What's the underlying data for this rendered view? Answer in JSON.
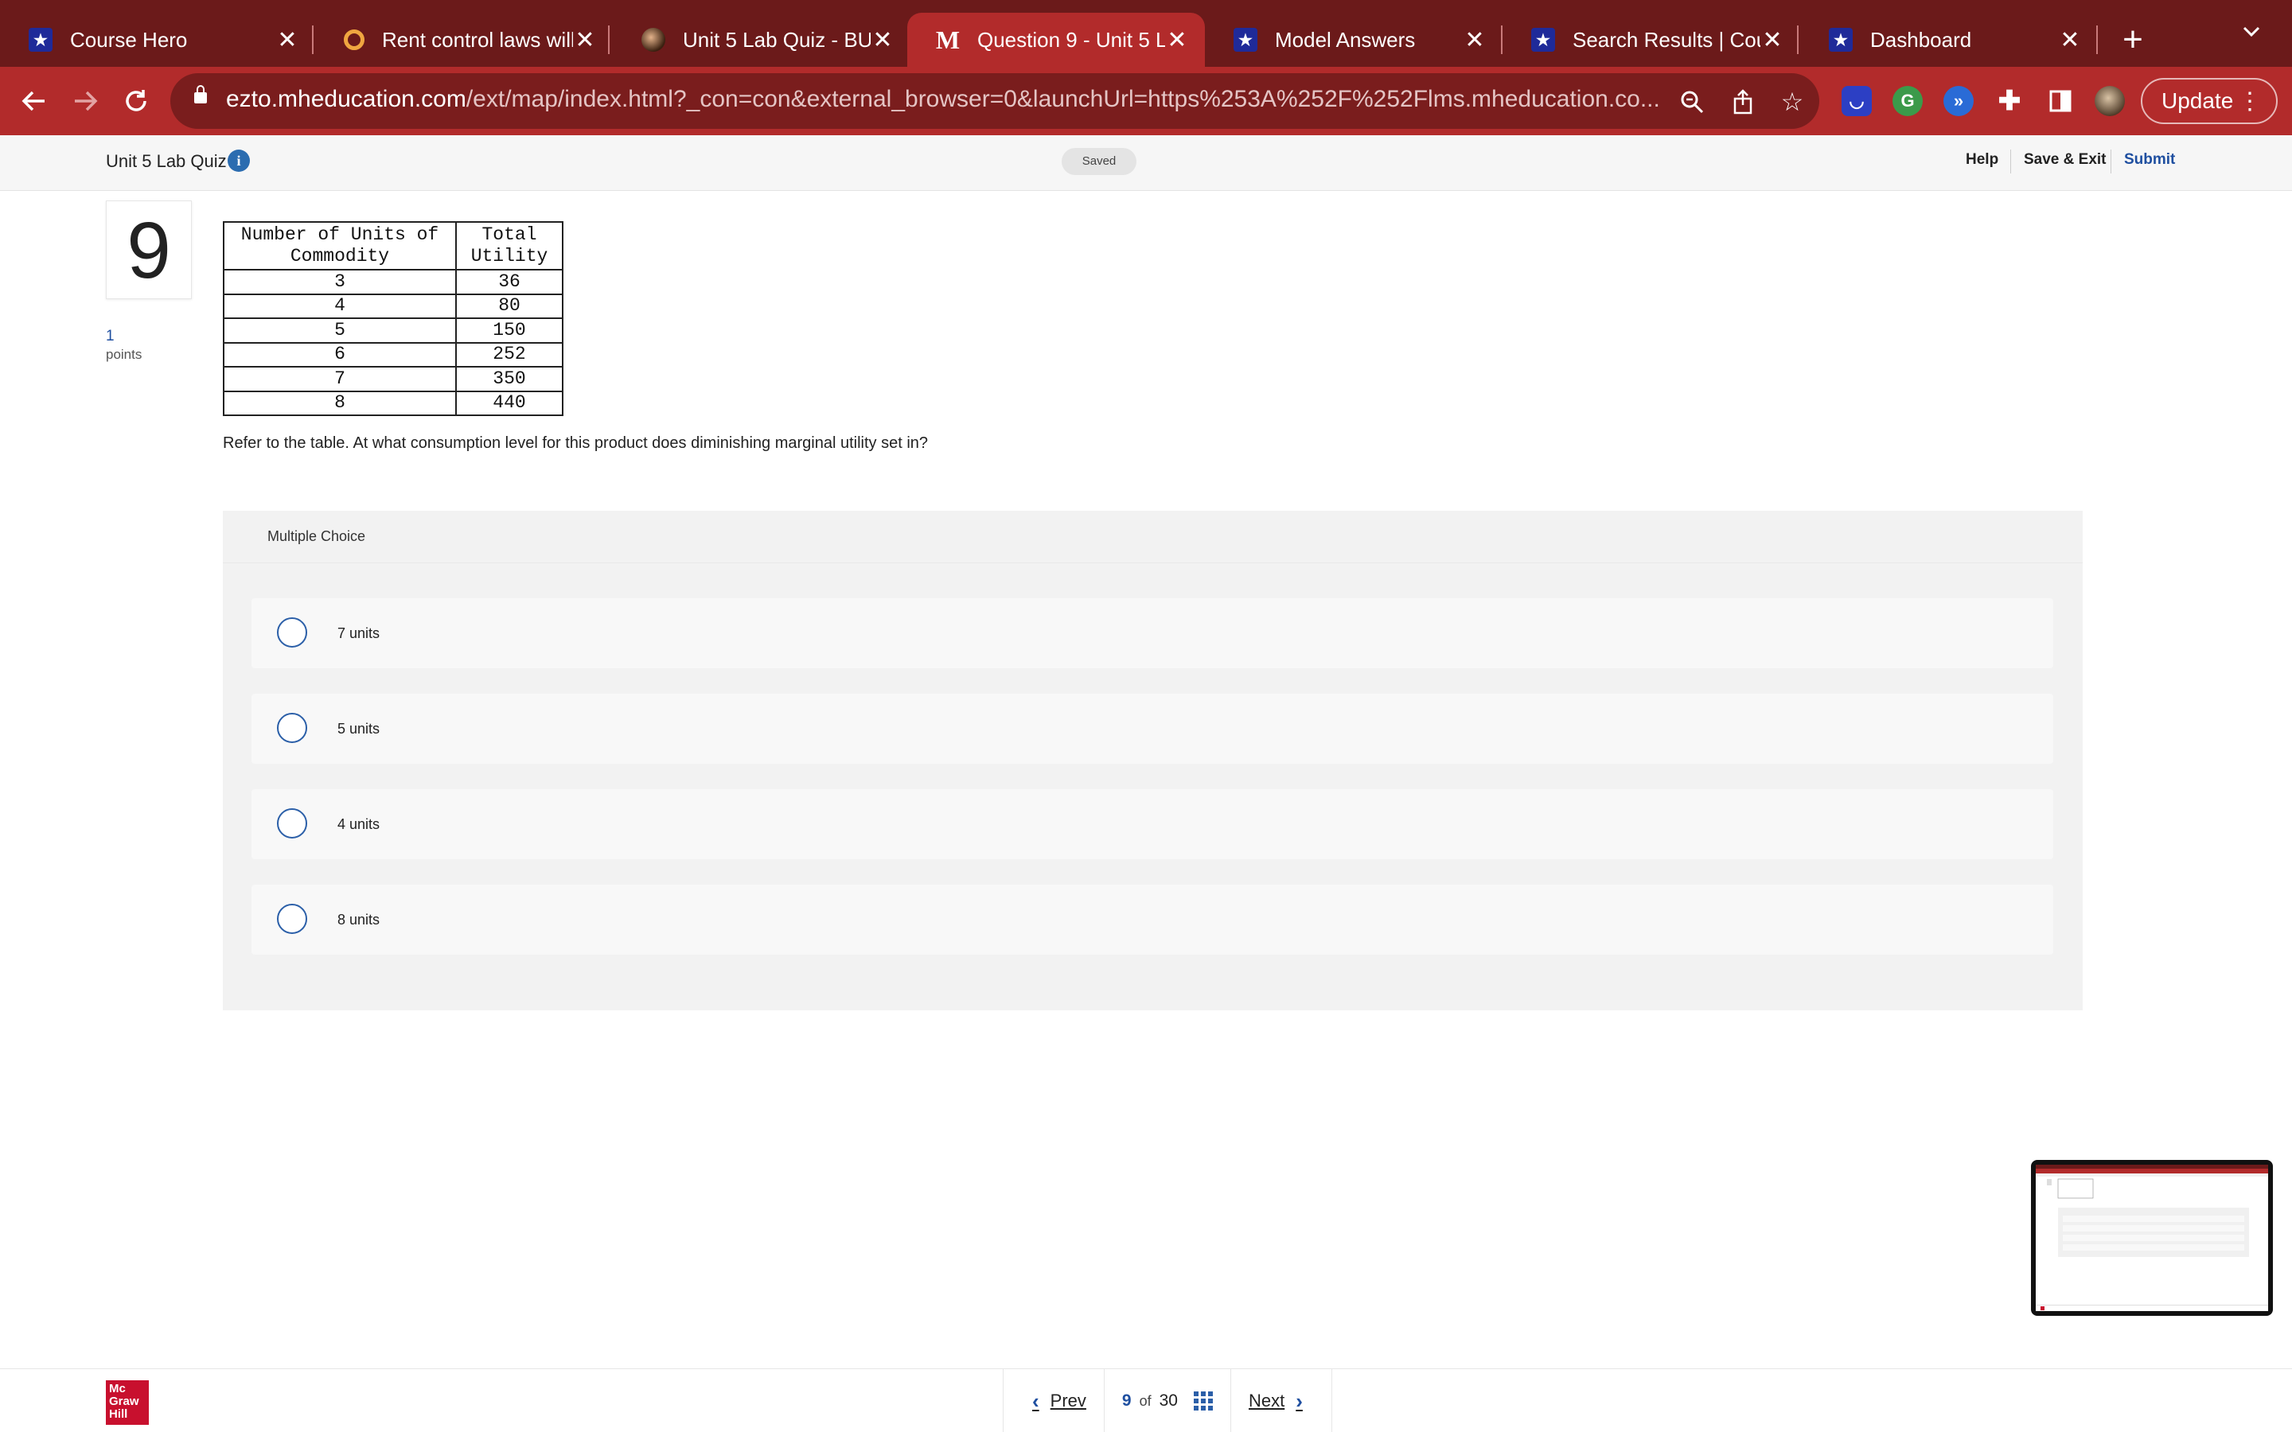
{
  "browser": {
    "tabs": [
      {
        "title": "Course Hero",
        "icon": "star-bookmark-icon",
        "active": false
      },
      {
        "title": "Rent control laws will",
        "icon": "ring-icon",
        "active": false
      },
      {
        "title": "Unit 5 Lab Quiz - BU",
        "icon": "profile-photo-icon",
        "active": false
      },
      {
        "title": "Question 9 - Unit 5 L",
        "icon": "mcgraw-m-icon",
        "active": true
      },
      {
        "title": "Model Answers",
        "icon": "star-bookmark-icon",
        "active": false
      },
      {
        "title": "Search Results | Cou",
        "icon": "star-bookmark-icon",
        "active": false
      },
      {
        "title": "Dashboard",
        "icon": "star-bookmark-icon",
        "active": false
      }
    ],
    "url_host": "ezto.mheducation.com",
    "url_rest": "/ext/map/index.html?_con=con&external_browser=0&launchUrl=https%253A%252F%252Flms.mheducation.co...",
    "update_label": "Update",
    "colors": {
      "tabbar": "#6b1a1a",
      "toolbar": "#b22b2b"
    }
  },
  "header": {
    "quiz_title": "Unit 5 Lab Quiz",
    "status": "Saved",
    "help": "Help",
    "save_exit": "Save & Exit",
    "submit": "Submit"
  },
  "question": {
    "number": "9",
    "points_value": "1",
    "points_label": "points",
    "table": {
      "headers": [
        [
          "Number of Units of",
          "Commodity"
        ],
        [
          "Total",
          "Utility"
        ]
      ],
      "rows": [
        [
          "3",
          "36"
        ],
        [
          "4",
          "80"
        ],
        [
          "5",
          "150"
        ],
        [
          "6",
          "252"
        ],
        [
          "7",
          "350"
        ],
        [
          "8",
          "440"
        ]
      ]
    },
    "prompt": "Refer to the table. At what consumption level for this product does diminishing marginal utility set in?",
    "section_label": "Multiple Choice",
    "choices": [
      "7 units",
      "5 units",
      "4 units",
      "8 units"
    ]
  },
  "footer": {
    "logo_lines": [
      "Mc",
      "Graw",
      "Hill"
    ],
    "prev": "Prev",
    "current": "9",
    "of": "of",
    "total": "30",
    "next": "Next"
  }
}
